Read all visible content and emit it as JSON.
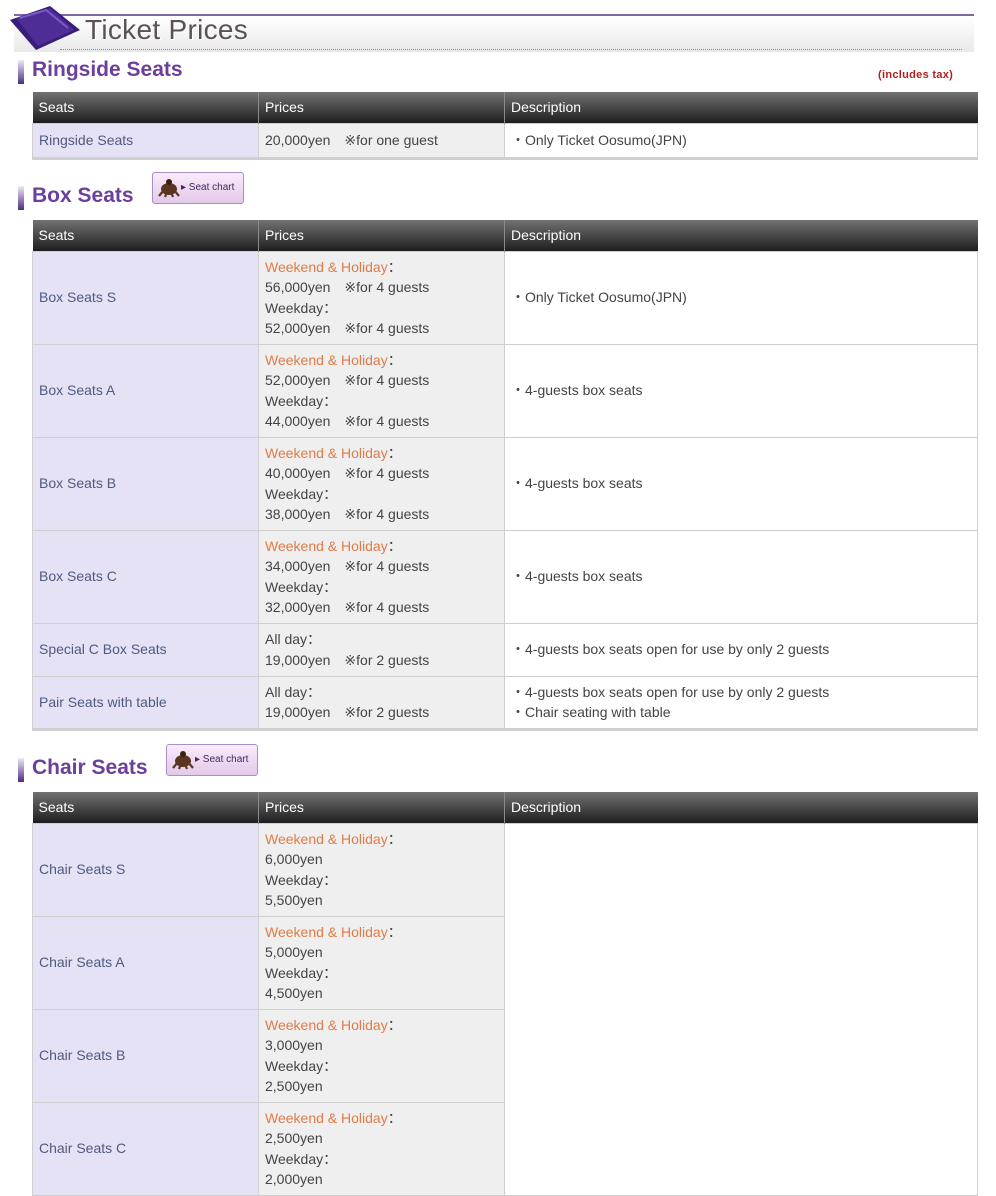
{
  "page_title": "Ticket Prices",
  "tax_note": "(includes tax)",
  "seat_chart_label": "▸ Seat chart",
  "columns": [
    "Seats",
    "Prices",
    "Description"
  ],
  "labels": {
    "weekend": "Weekend & Holiday",
    "weekday": "Weekday",
    "allday": "All day",
    "colon": "：",
    "note_4": "※for 4 guests",
    "note_2": "※for 2 guests",
    "note_1": "※for one guest"
  },
  "sections": {
    "ringside": {
      "title": "Ringside Seats",
      "rows": [
        {
          "seat": "Ringside Seats",
          "price": "20,000yen",
          "note": "※for one guest",
          "desc": "・Only Ticket Oosumo(JPN)"
        }
      ]
    },
    "box": {
      "title": "Box Seats",
      "rows": [
        {
          "seat": "Box Seats S",
          "weekend_price": "56,000yen",
          "weekday_price": "52,000yen",
          "note": "※for 4 guests",
          "desc": "・Only Ticket Oosumo(JPN)"
        },
        {
          "seat": "Box Seats A",
          "weekend_price": "52,000yen",
          "weekday_price": "44,000yen",
          "note": "※for 4 guests",
          "desc": "・4-guests box seats"
        },
        {
          "seat": "Box Seats B",
          "weekend_price": "40,000yen",
          "weekday_price": "38,000yen",
          "note": "※for 4 guests",
          "desc": "・4-guests box seats"
        },
        {
          "seat": "Box Seats C",
          "weekend_price": "34,000yen",
          "weekday_price": "32,000yen",
          "note": "※for 4 guests",
          "desc": "・4-guests box seats"
        },
        {
          "seat": "Special C Box Seats",
          "allday_price": "19,000yen",
          "note": "※for 2 guests",
          "desc": "・4-guests box seats open for use by only 2 guests"
        },
        {
          "seat": "Pair Seats with table",
          "allday_price": "19,000yen",
          "note": "※for 2 guests",
          "desc": "・4-guests box seats open for use by only 2 guests",
          "desc2": "・Chair seating with table"
        }
      ]
    },
    "chair": {
      "title": "Chair Seats",
      "rows": [
        {
          "seat": "Chair Seats S",
          "weekend_price": "6,000yen",
          "weekday_price": "5,500yen"
        },
        {
          "seat": "Chair Seats A",
          "weekend_price": "5,000yen",
          "weekday_price": "4,500yen"
        },
        {
          "seat": "Chair Seats B",
          "weekend_price": "3,000yen",
          "weekday_price": "2,500yen"
        },
        {
          "seat": "Chair Seats C",
          "weekend_price": "2,500yen",
          "weekday_price": "2,000yen"
        }
      ]
    }
  },
  "colors": {
    "section_title": "#6b3f9b",
    "weekend_label": "#e07b48",
    "seat_cell_bg": "#e4e2f4",
    "tax_note": "#b3201c"
  },
  "icons": [
    "cushion-icon",
    "sumo-wrestler-icon"
  ]
}
